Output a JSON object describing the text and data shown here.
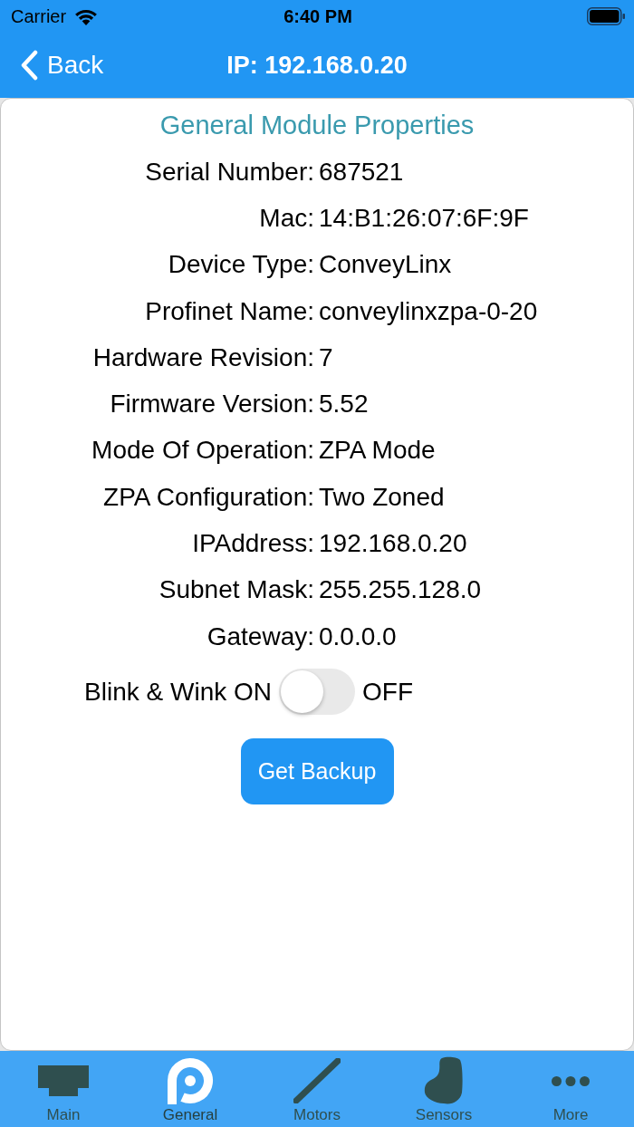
{
  "status_bar": {
    "carrier": "Carrier",
    "time": "6:40 PM"
  },
  "nav_bar": {
    "back": "Back",
    "title": "IP: 192.168.0.20"
  },
  "section_title": "General Module Properties",
  "properties": [
    {
      "label": "Serial Number:",
      "value": "687521"
    },
    {
      "label": "Mac:",
      "value": "14:B1:26:07:6F:9F"
    },
    {
      "label": "Device Type:",
      "value": "ConveyLinx"
    },
    {
      "label": "Profinet Name:",
      "value": "conveylinxzpa-0-20"
    },
    {
      "label": "Hardware Revision:",
      "value": "7"
    },
    {
      "label": "Firmware Version:",
      "value": "5.52"
    },
    {
      "label": "Mode Of Operation:",
      "value": "ZPA Mode"
    },
    {
      "label": "ZPA Configuration:",
      "value": "Two Zoned"
    },
    {
      "label": "IPAddress:",
      "value": "192.168.0.20"
    },
    {
      "label": "Subnet Mask:",
      "value": "255.255.128.0"
    },
    {
      "label": "Gateway:",
      "value": "0.0.0.0"
    }
  ],
  "blink_wink": {
    "label": "Blink & Wink ON",
    "off_label": "OFF",
    "on": false
  },
  "backup_button": "Get Backup",
  "tabs": [
    {
      "label": "Main",
      "selected": false
    },
    {
      "label": "General",
      "selected": true
    },
    {
      "label": "Motors",
      "selected": false
    },
    {
      "label": "Sensors",
      "selected": false
    },
    {
      "label": "More",
      "selected": false
    }
  ]
}
